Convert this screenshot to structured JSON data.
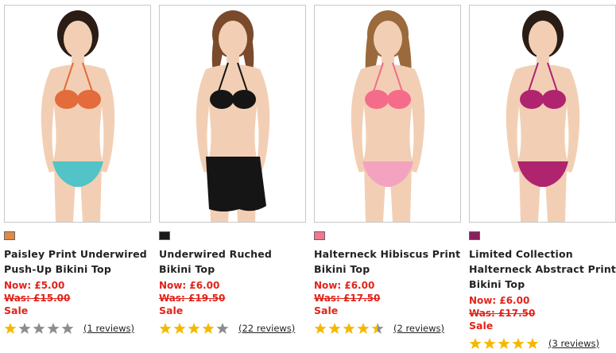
{
  "products": [
    {
      "name": "Paisley Print Underwired Push-Up Bikini Top",
      "now": "Now: £5.00",
      "was": "Was: £15.00",
      "sale": "Sale",
      "rating": 1,
      "reviews": "(1 reviews)",
      "swatch_color": "#e08a45",
      "bikini_colors": [
        "#e46b3c",
        "#52c3c6"
      ]
    },
    {
      "name": "Underwired Ruched Bikini Top",
      "now": "Now: £6.00",
      "was": "Was: £19.50",
      "sale": "Sale",
      "rating": 4,
      "reviews": "(22 reviews)",
      "swatch_color": "#1a1a1a",
      "bikini_colors": [
        "#151515",
        "#151515"
      ]
    },
    {
      "name": "Halterneck Hibiscus Print Bikini Top",
      "now": "Now: £6.00",
      "was": "Was: £17.50",
      "sale": "Sale",
      "rating": 4.5,
      "reviews": "(2 reviews)",
      "swatch_color": "#f0788e",
      "bikini_colors": [
        "#f56c8a",
        "#f3a3c0"
      ]
    },
    {
      "name": "Limited Collection Halterneck Abstract Print Bikini Top",
      "now": "Now: £6.00",
      "was": "Was: £17.50",
      "sale": "Sale",
      "rating": 5,
      "reviews": "(3 reviews)",
      "swatch_color": "#8a1f5e",
      "bikini_colors": [
        "#b0246f",
        "#b0246f"
      ]
    }
  ],
  "colors": {
    "price_red": "#e2231a",
    "star_gold": "#f5b800",
    "star_grey": "#8d8d8d"
  }
}
